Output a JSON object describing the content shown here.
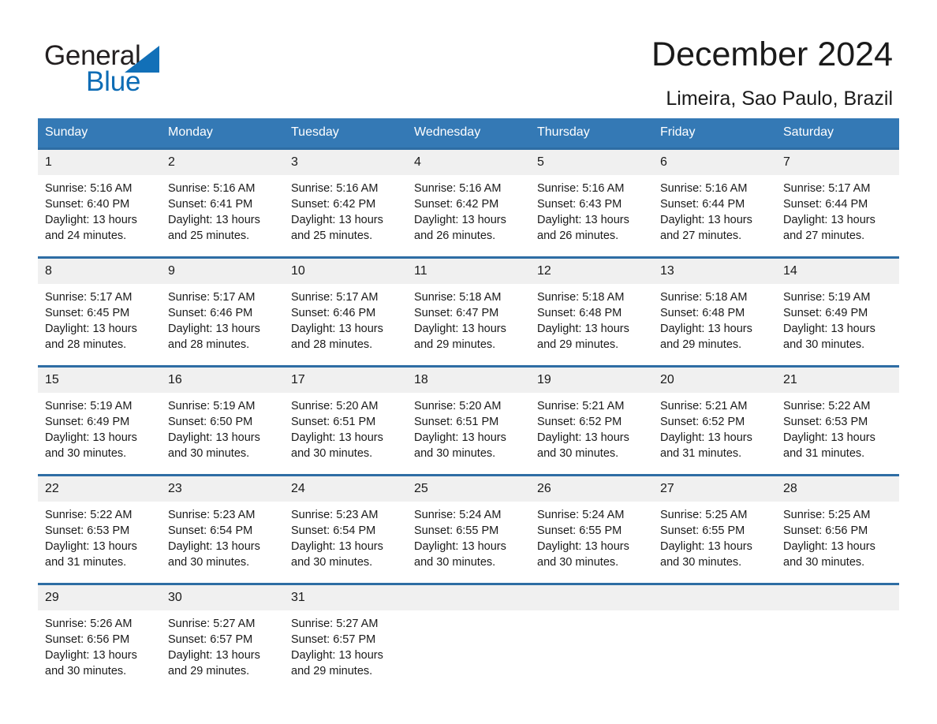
{
  "brand": {
    "word1": "General",
    "word2": "Blue",
    "triangle_color": "#1270b8",
    "blue": "#0d6cb5"
  },
  "header": {
    "month_title": "December 2024",
    "location": "Limeira, Sao Paulo, Brazil"
  },
  "theme": {
    "header_blue": "#3479b5",
    "row_border_blue": "#2e6da4",
    "day_band_gray": "#f0f0f0"
  },
  "weekdays": [
    "Sunday",
    "Monday",
    "Tuesday",
    "Wednesday",
    "Thursday",
    "Friday",
    "Saturday"
  ],
  "weeks": [
    [
      {
        "day": "1",
        "sunrise": "Sunrise: 5:16 AM",
        "sunset": "Sunset: 6:40 PM",
        "daylight_line1": "Daylight: 13 hours",
        "daylight_line2": "and 24 minutes."
      },
      {
        "day": "2",
        "sunrise": "Sunrise: 5:16 AM",
        "sunset": "Sunset: 6:41 PM",
        "daylight_line1": "Daylight: 13 hours",
        "daylight_line2": "and 25 minutes."
      },
      {
        "day": "3",
        "sunrise": "Sunrise: 5:16 AM",
        "sunset": "Sunset: 6:42 PM",
        "daylight_line1": "Daylight: 13 hours",
        "daylight_line2": "and 25 minutes."
      },
      {
        "day": "4",
        "sunrise": "Sunrise: 5:16 AM",
        "sunset": "Sunset: 6:42 PM",
        "daylight_line1": "Daylight: 13 hours",
        "daylight_line2": "and 26 minutes."
      },
      {
        "day": "5",
        "sunrise": "Sunrise: 5:16 AM",
        "sunset": "Sunset: 6:43 PM",
        "daylight_line1": "Daylight: 13 hours",
        "daylight_line2": "and 26 minutes."
      },
      {
        "day": "6",
        "sunrise": "Sunrise: 5:16 AM",
        "sunset": "Sunset: 6:44 PM",
        "daylight_line1": "Daylight: 13 hours",
        "daylight_line2": "and 27 minutes."
      },
      {
        "day": "7",
        "sunrise": "Sunrise: 5:17 AM",
        "sunset": "Sunset: 6:44 PM",
        "daylight_line1": "Daylight: 13 hours",
        "daylight_line2": "and 27 minutes."
      }
    ],
    [
      {
        "day": "8",
        "sunrise": "Sunrise: 5:17 AM",
        "sunset": "Sunset: 6:45 PM",
        "daylight_line1": "Daylight: 13 hours",
        "daylight_line2": "and 28 minutes."
      },
      {
        "day": "9",
        "sunrise": "Sunrise: 5:17 AM",
        "sunset": "Sunset: 6:46 PM",
        "daylight_line1": "Daylight: 13 hours",
        "daylight_line2": "and 28 minutes."
      },
      {
        "day": "10",
        "sunrise": "Sunrise: 5:17 AM",
        "sunset": "Sunset: 6:46 PM",
        "daylight_line1": "Daylight: 13 hours",
        "daylight_line2": "and 28 minutes."
      },
      {
        "day": "11",
        "sunrise": "Sunrise: 5:18 AM",
        "sunset": "Sunset: 6:47 PM",
        "daylight_line1": "Daylight: 13 hours",
        "daylight_line2": "and 29 minutes."
      },
      {
        "day": "12",
        "sunrise": "Sunrise: 5:18 AM",
        "sunset": "Sunset: 6:48 PM",
        "daylight_line1": "Daylight: 13 hours",
        "daylight_line2": "and 29 minutes."
      },
      {
        "day": "13",
        "sunrise": "Sunrise: 5:18 AM",
        "sunset": "Sunset: 6:48 PM",
        "daylight_line1": "Daylight: 13 hours",
        "daylight_line2": "and 29 minutes."
      },
      {
        "day": "14",
        "sunrise": "Sunrise: 5:19 AM",
        "sunset": "Sunset: 6:49 PM",
        "daylight_line1": "Daylight: 13 hours",
        "daylight_line2": "and 30 minutes."
      }
    ],
    [
      {
        "day": "15",
        "sunrise": "Sunrise: 5:19 AM",
        "sunset": "Sunset: 6:49 PM",
        "daylight_line1": "Daylight: 13 hours",
        "daylight_line2": "and 30 minutes."
      },
      {
        "day": "16",
        "sunrise": "Sunrise: 5:19 AM",
        "sunset": "Sunset: 6:50 PM",
        "daylight_line1": "Daylight: 13 hours",
        "daylight_line2": "and 30 minutes."
      },
      {
        "day": "17",
        "sunrise": "Sunrise: 5:20 AM",
        "sunset": "Sunset: 6:51 PM",
        "daylight_line1": "Daylight: 13 hours",
        "daylight_line2": "and 30 minutes."
      },
      {
        "day": "18",
        "sunrise": "Sunrise: 5:20 AM",
        "sunset": "Sunset: 6:51 PM",
        "daylight_line1": "Daylight: 13 hours",
        "daylight_line2": "and 30 minutes."
      },
      {
        "day": "19",
        "sunrise": "Sunrise: 5:21 AM",
        "sunset": "Sunset: 6:52 PM",
        "daylight_line1": "Daylight: 13 hours",
        "daylight_line2": "and 30 minutes."
      },
      {
        "day": "20",
        "sunrise": "Sunrise: 5:21 AM",
        "sunset": "Sunset: 6:52 PM",
        "daylight_line1": "Daylight: 13 hours",
        "daylight_line2": "and 31 minutes."
      },
      {
        "day": "21",
        "sunrise": "Sunrise: 5:22 AM",
        "sunset": "Sunset: 6:53 PM",
        "daylight_line1": "Daylight: 13 hours",
        "daylight_line2": "and 31 minutes."
      }
    ],
    [
      {
        "day": "22",
        "sunrise": "Sunrise: 5:22 AM",
        "sunset": "Sunset: 6:53 PM",
        "daylight_line1": "Daylight: 13 hours",
        "daylight_line2": "and 31 minutes."
      },
      {
        "day": "23",
        "sunrise": "Sunrise: 5:23 AM",
        "sunset": "Sunset: 6:54 PM",
        "daylight_line1": "Daylight: 13 hours",
        "daylight_line2": "and 30 minutes."
      },
      {
        "day": "24",
        "sunrise": "Sunrise: 5:23 AM",
        "sunset": "Sunset: 6:54 PM",
        "daylight_line1": "Daylight: 13 hours",
        "daylight_line2": "and 30 minutes."
      },
      {
        "day": "25",
        "sunrise": "Sunrise: 5:24 AM",
        "sunset": "Sunset: 6:55 PM",
        "daylight_line1": "Daylight: 13 hours",
        "daylight_line2": "and 30 minutes."
      },
      {
        "day": "26",
        "sunrise": "Sunrise: 5:24 AM",
        "sunset": "Sunset: 6:55 PM",
        "daylight_line1": "Daylight: 13 hours",
        "daylight_line2": "and 30 minutes."
      },
      {
        "day": "27",
        "sunrise": "Sunrise: 5:25 AM",
        "sunset": "Sunset: 6:55 PM",
        "daylight_line1": "Daylight: 13 hours",
        "daylight_line2": "and 30 minutes."
      },
      {
        "day": "28",
        "sunrise": "Sunrise: 5:25 AM",
        "sunset": "Sunset: 6:56 PM",
        "daylight_line1": "Daylight: 13 hours",
        "daylight_line2": "and 30 minutes."
      }
    ],
    [
      {
        "day": "29",
        "sunrise": "Sunrise: 5:26 AM",
        "sunset": "Sunset: 6:56 PM",
        "daylight_line1": "Daylight: 13 hours",
        "daylight_line2": "and 30 minutes."
      },
      {
        "day": "30",
        "sunrise": "Sunrise: 5:27 AM",
        "sunset": "Sunset: 6:57 PM",
        "daylight_line1": "Daylight: 13 hours",
        "daylight_line2": "and 29 minutes."
      },
      {
        "day": "31",
        "sunrise": "Sunrise: 5:27 AM",
        "sunset": "Sunset: 6:57 PM",
        "daylight_line1": "Daylight: 13 hours",
        "daylight_line2": "and 29 minutes."
      },
      {
        "day": "",
        "sunrise": "",
        "sunset": "",
        "daylight_line1": "",
        "daylight_line2": ""
      },
      {
        "day": "",
        "sunrise": "",
        "sunset": "",
        "daylight_line1": "",
        "daylight_line2": ""
      },
      {
        "day": "",
        "sunrise": "",
        "sunset": "",
        "daylight_line1": "",
        "daylight_line2": ""
      },
      {
        "day": "",
        "sunrise": "",
        "sunset": "",
        "daylight_line1": "",
        "daylight_line2": ""
      }
    ]
  ]
}
